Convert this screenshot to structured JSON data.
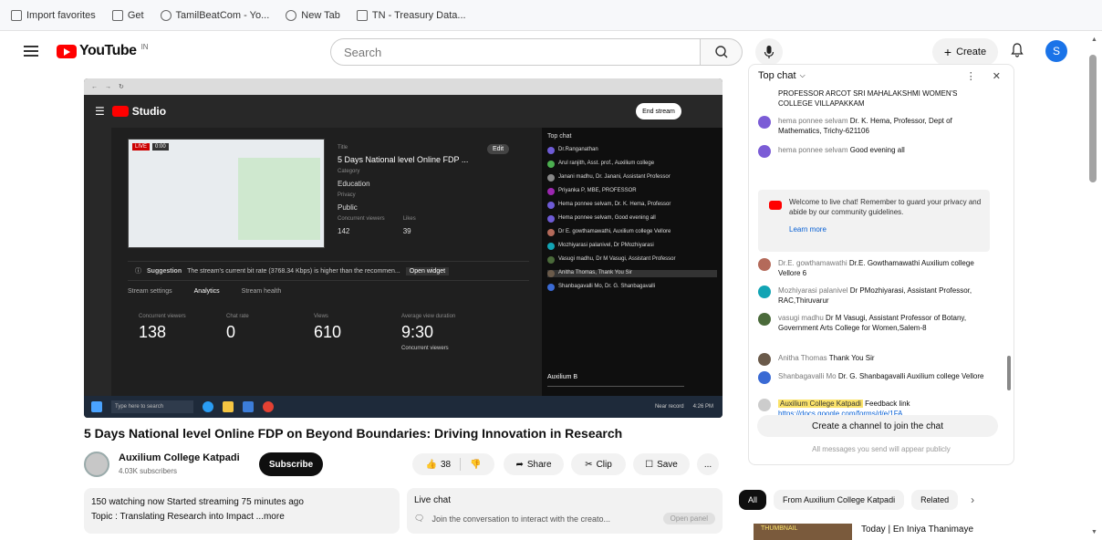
{
  "bookmarks": [
    {
      "label": "Import favorites"
    },
    {
      "label": "Get"
    },
    {
      "label": "TamilBeatCom - Yo..."
    },
    {
      "label": "New Tab"
    },
    {
      "label": "TN - Treasury Data..."
    }
  ],
  "header": {
    "logo": "YouTube",
    "logo_suffix": "IN",
    "search_placeholder": "Search",
    "create_label": "Create",
    "avatar_letter": "S"
  },
  "player": {
    "studio_logo": "Studio",
    "go_live": "End stream",
    "preview_badges": [
      "LIVE",
      "0:00"
    ],
    "info": {
      "title_label": "Title",
      "title": "5 Days National level Online FDP ...",
      "edit": "Edit",
      "category_label": "Category",
      "category": "Education",
      "privacy_label": "Privacy",
      "privacy": "Public",
      "concurrent_label": "Concurrent viewers",
      "concurrent": "142",
      "likes_label": "Likes",
      "likes": "39"
    },
    "suggestion_label": "Suggestion",
    "suggestion_text": "The stream's current bit rate (3768.34 Kbps) is higher than the recommen...",
    "suggestion_link": "Open widget",
    "tabs": [
      "Stream settings",
      "Analytics",
      "Stream health"
    ],
    "stats": [
      {
        "label": "Concurrent viewers",
        "value": "138"
      },
      {
        "label": "Chat rate",
        "value": "0"
      },
      {
        "label": "Views",
        "value": "610"
      },
      {
        "label": "Average view duration",
        "value": "9:30"
      }
    ],
    "stats_sub": "Concurrent viewers",
    "chat_title": "Top chat",
    "chat_lines": [
      "Dr.Ranganathan",
      "Arul ranjith, Asst. prof., Auxilium college",
      "Janani madhu, Dr. Janani, Assistant Professor",
      "Priyanka P, MBE, PROFESSOR",
      "Hema ponnee selvam, Dr. K. Hema, Professor",
      "Hema ponnee selvam, Good evening all",
      "Dr E. gowthamawathi, Auxilium college Vellore",
      "Mozhiyarasi palanivel, Dr PMozhiyarasi",
      "Vasugi madhu, Dr M Vasugi, Assistant Professor",
      "Anitha Thomas, Thank You Sir",
      "Shanbagavalli Mo, Dr. G. Shanbagavalli"
    ],
    "chat_input": "Auxilium B",
    "taskbar_search": "Type here to search",
    "taskbar_weather": "Near record",
    "taskbar_time": "4:26 PM"
  },
  "video": {
    "title": "5 Days National level Online FDP on Beyond Boundaries: Driving Innovation in Research",
    "channel": "Auxilium College Katpadi",
    "subscribers": "4.03K subscribers",
    "subscribe": "Subscribe",
    "likes": "38",
    "share": "Share",
    "clip": "Clip",
    "save": "Save",
    "more": "..."
  },
  "description": {
    "line1": "150 watching now Started streaming 75 minutes ago",
    "line2": "Topic : Translating Research into Impact ...more"
  },
  "livechat_box": {
    "title": "Live chat",
    "join_text": "Join the conversation to interact with the creato...",
    "open_panel": "Open panel"
  },
  "chat": {
    "title": "Top chat",
    "messages": [
      {
        "author": "",
        "text": "PROFESSOR ARCOT SRI MAHALAKSHMI WOMEN'S COLLEGE VILLAPAKKAM",
        "color": "#ffffff"
      },
      {
        "author": "hema ponnee selvam",
        "text": "Dr. K. Hema, Professor, Dept of Mathematics, Trichy-621106",
        "color": "#7b5cd6"
      },
      {
        "author": "hema ponnee selvam",
        "text": "Good evening all",
        "color": "#7b5cd6"
      },
      {
        "author": "Dr.E. gowthamawathi",
        "text": "Dr.E. Gowthamawathi Auxilium college Vellore 6",
        "color": "#b46a5a"
      },
      {
        "author": "Mozhiyarasi palanivel",
        "text": "Dr PMozhiyarasi, Assistant Professor, RAC,Thiruvarur",
        "color": "#12a4b4"
      },
      {
        "author": "vasugi madhu",
        "text": "Dr M Vasugi, Assistant Professor of Botany, Government Arts College for Women,Salem-8",
        "color": "#4a6a3a"
      },
      {
        "author": "Anitha Thomas",
        "text": "Thank You Sir",
        "color": "#6a5a4a"
      },
      {
        "author": "Shanbagavalli Mo",
        "text": "Dr. G. Shanbagavalli Auxilium college Vellore",
        "color": "#3a6ad4"
      },
      {
        "author": "Auxilium College Katpadi",
        "text": "Feedback link",
        "link": "https://docs.google.com/forms/d/e/1FA...",
        "color": "#cccccc"
      }
    ],
    "welcome_text": "Welcome to live chat! Remember to guard your privacy and abide by our community guidelines.",
    "welcome_link": "Learn more",
    "create_channel": "Create a channel to join the chat",
    "disclaimer": "All messages you send will appear publicly"
  },
  "chips": [
    "All",
    "From Auxilium College Katpadi",
    "Related"
  ],
  "recommendation": {
    "thumb_text": "THUMBNAIL",
    "title": "Today | En Iniya Thanimaye"
  }
}
